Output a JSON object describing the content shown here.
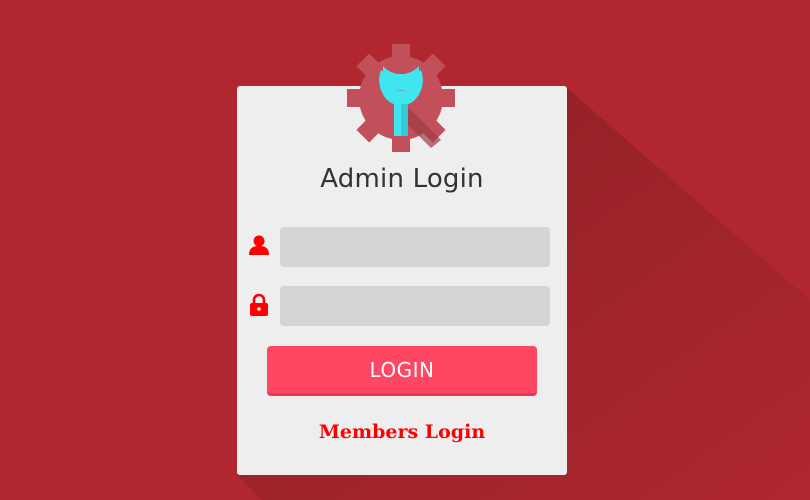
{
  "page": {
    "background_color": "#b0272f",
    "card_color": "#eeeeee"
  },
  "logo": {
    "icon": "gear-wrench-icon",
    "gear_color": "#c2505b",
    "wrench_color": "#3fe6f0"
  },
  "form": {
    "title": "Admin Login",
    "username": {
      "icon": "user-icon",
      "value": "",
      "placeholder": ""
    },
    "password": {
      "icon": "lock-icon",
      "value": "",
      "placeholder": ""
    },
    "login_button_label": "LOGIN",
    "accent_color": "#ff4662",
    "icon_color": "#ff0000"
  },
  "members_link": {
    "label": "Members Login"
  }
}
